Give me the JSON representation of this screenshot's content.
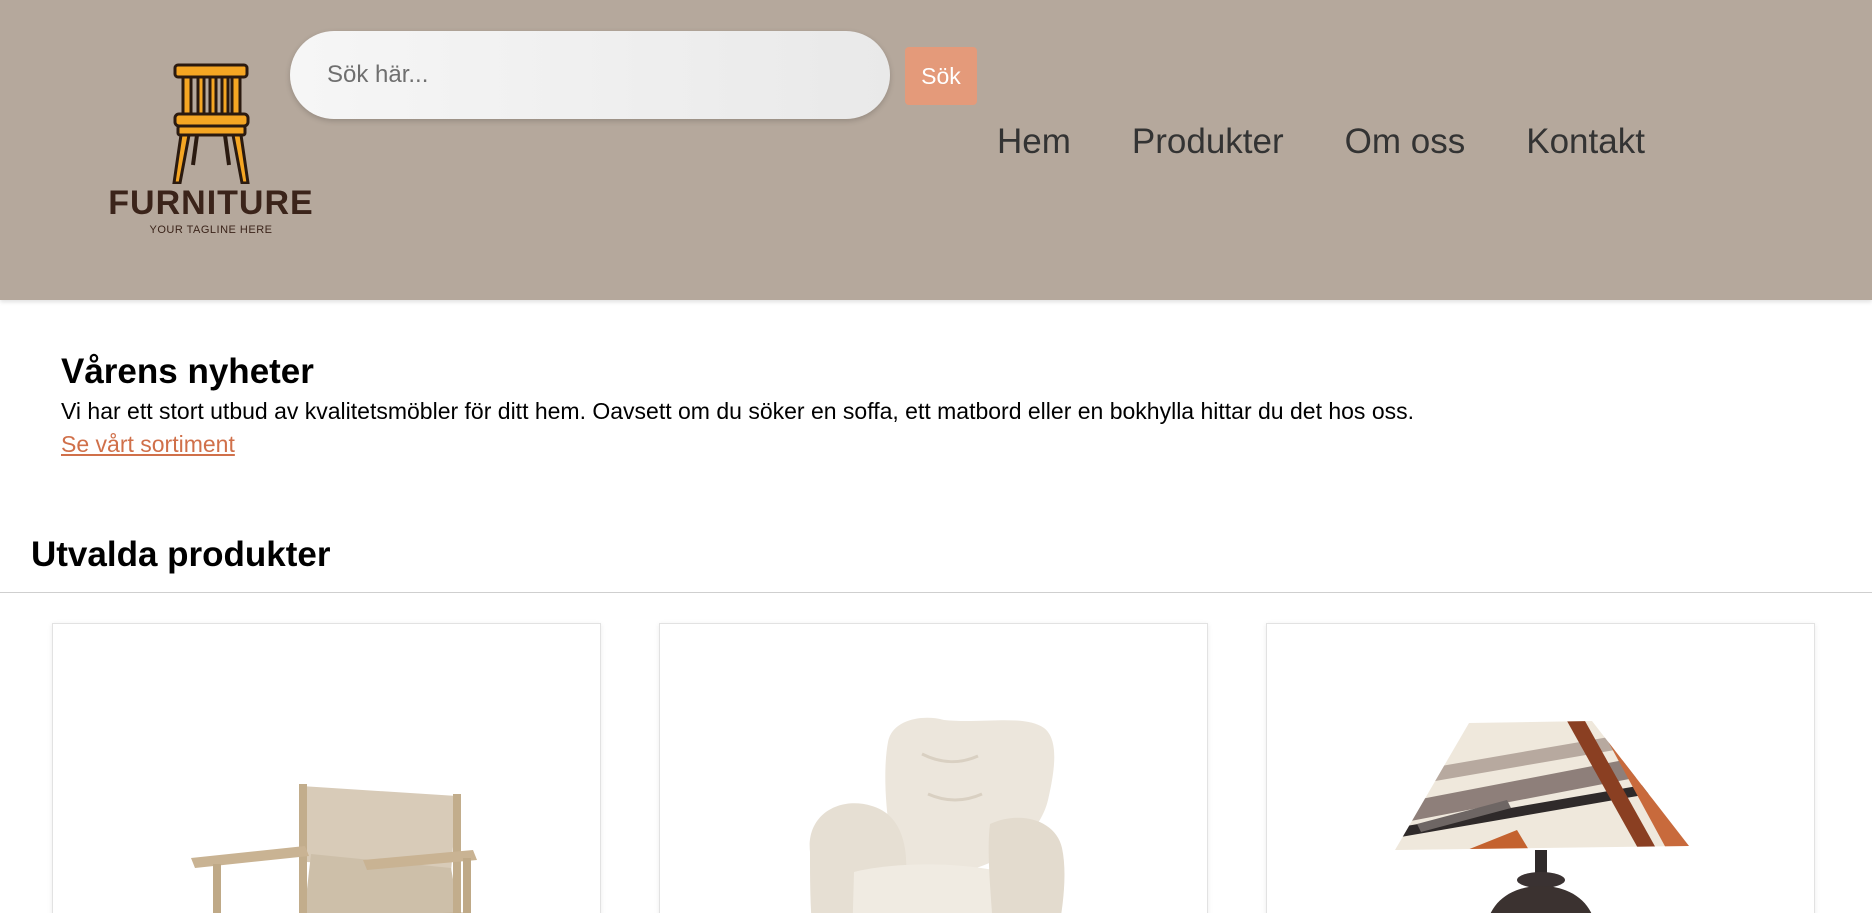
{
  "brand": {
    "name": "FURNITURE",
    "tagline": "YOUR TAGLINE HERE",
    "icon": "chair-logo-icon"
  },
  "search": {
    "placeholder": "Sök här...",
    "value": "",
    "button_label": "Sök"
  },
  "nav": {
    "items": [
      {
        "label": "Hem"
      },
      {
        "label": "Produkter"
      },
      {
        "label": "Om oss"
      },
      {
        "label": "Kontakt"
      }
    ]
  },
  "hero": {
    "title": "Vårens nyheter",
    "text": "Vi har ett stort utbud av kvalitetsmöbler för ditt hem. Oavsett om du söker en soffa, ett matbord eller en bokhylla hittar du det hos oss.",
    "link_label": "Se vårt sortiment"
  },
  "featured": {
    "title": "Utvalda produkter",
    "products": [
      {
        "image": "canvas-armchair-image"
      },
      {
        "image": "sheepskin-wingback-chair-image"
      },
      {
        "image": "striped-table-lamp-image"
      }
    ]
  },
  "colors": {
    "header_bg": "#b5a89c",
    "accent": "#e49a7a",
    "link": "#d0704a",
    "logo_text": "#3b241a",
    "logo_chair": "#f5a623"
  }
}
